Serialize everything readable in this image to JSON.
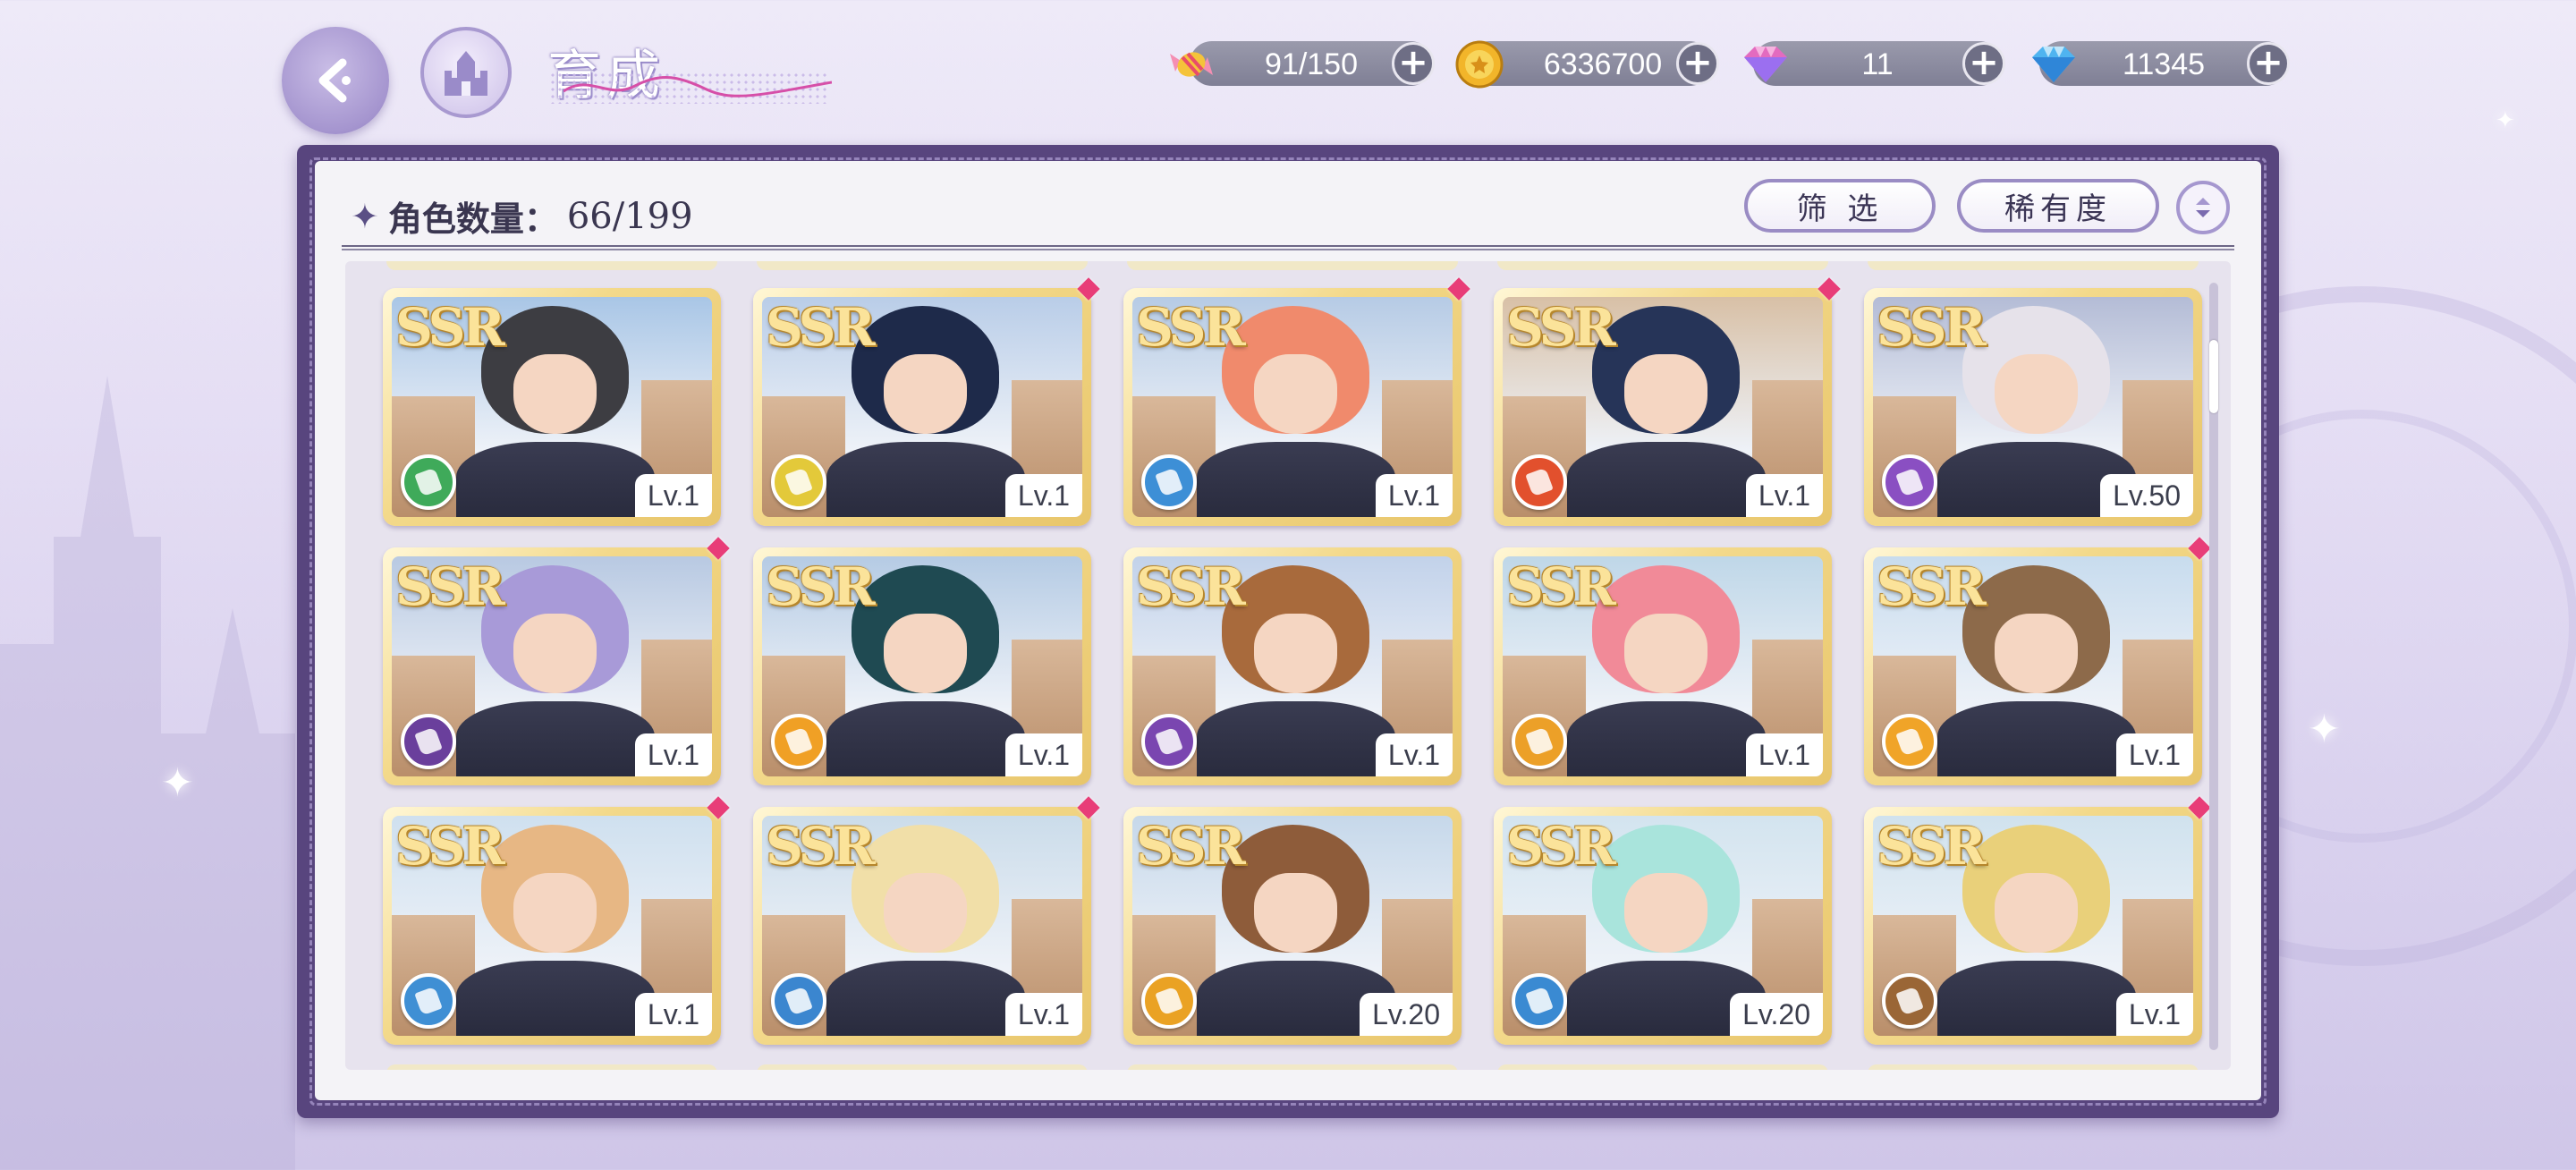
{
  "header": {
    "title": "育成"
  },
  "resources": [
    {
      "name": "candy",
      "value": "91/150"
    },
    {
      "name": "gold-coin",
      "value": "6336700"
    },
    {
      "name": "pink-diamond",
      "value": "11"
    },
    {
      "name": "blue-diamond",
      "value": "11345"
    }
  ],
  "panel": {
    "count_label": "角色数量：",
    "count_value": "66/199",
    "filter_label": "筛 选",
    "sort_label": "稀有度"
  },
  "cards": [
    {
      "rarity": "SSR",
      "level": "Lv.1",
      "type_color": "#3faa5a",
      "new": false,
      "hair": "#3d3d42",
      "sky": "#a9c6e6"
    },
    {
      "rarity": "SSR",
      "level": "Lv.1",
      "type_color": "#e3c93a",
      "new": true,
      "hair": "#1e2a4a",
      "sky": "#b9cde8"
    },
    {
      "rarity": "SSR",
      "level": "Lv.1",
      "type_color": "#3d8fd6",
      "new": true,
      "hair": "#f08a6c",
      "sky": "#b6cbe5"
    },
    {
      "rarity": "SSR",
      "level": "Lv.1",
      "type_color": "#e2502d",
      "new": true,
      "hair": "#263458",
      "sky": "#d8c0a6"
    },
    {
      "rarity": "SSR",
      "level": "Lv.50",
      "type_color": "#8a4fc2",
      "new": false,
      "hair": "#e6e2ea",
      "sky": "#b4bcd6"
    },
    {
      "rarity": "SSR",
      "level": "Lv.1",
      "type_color": "#6a3f9c",
      "new": true,
      "hair": "#a89ad8",
      "sky": "#b8c9e2"
    },
    {
      "rarity": "SSR",
      "level": "Lv.1",
      "type_color": "#f0a025",
      "new": false,
      "hair": "#1f4a52",
      "sky": "#b5cbe4"
    },
    {
      "rarity": "SSR",
      "level": "Lv.1",
      "type_color": "#7a46b0",
      "new": false,
      "hair": "#a86a3c",
      "sky": "#c2d2ea"
    },
    {
      "rarity": "SSR",
      "level": "Lv.1",
      "type_color": "#eca028",
      "new": false,
      "hair": "#f18a98",
      "sky": "#bfd7e8"
    },
    {
      "rarity": "SSR",
      "level": "Lv.1",
      "type_color": "#f0a428",
      "new": true,
      "hair": "#8d6a4a",
      "sky": "#c8dcee"
    },
    {
      "rarity": "SSR",
      "level": "Lv.1",
      "type_color": "#3f8fd4",
      "new": true,
      "hair": "#e7b784",
      "sky": "#cfe0ef"
    },
    {
      "rarity": "SSR",
      "level": "Lv.1",
      "type_color": "#3b86cf",
      "new": true,
      "hair": "#f1dfa8",
      "sky": "#cbdcea"
    },
    {
      "rarity": "SSR",
      "level": "Lv.20",
      "type_color": "#eaa224",
      "new": false,
      "hair": "#8e5c3a",
      "sky": "#c6d8ea"
    },
    {
      "rarity": "SSR",
      "level": "Lv.20",
      "type_color": "#3a8ad2",
      "new": false,
      "hair": "#a9e4dc",
      "sky": "#d3e4ef"
    },
    {
      "rarity": "SSR",
      "level": "Lv.1",
      "type_color": "#9a6636",
      "new": true,
      "hair": "#e9d07a",
      "sky": "#d0e2ee"
    }
  ]
}
